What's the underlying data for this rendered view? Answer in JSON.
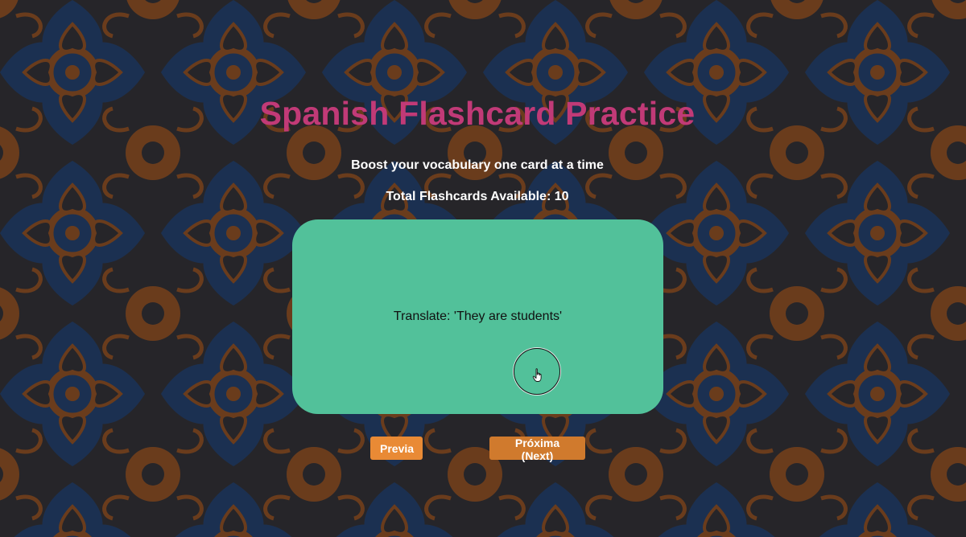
{
  "header": {
    "title": "Spanish Flashcard Practice",
    "subtitle": "Boost your vocabulary one card at a time",
    "total": "Total Flashcards Available: 10"
  },
  "card": {
    "prompt": "Translate: 'They are students'"
  },
  "controls": {
    "prev_label": "Previa",
    "next_label": "Próxima (Next)"
  },
  "colors": {
    "title": "#c13a77",
    "card": "#52c19a",
    "button_prev": "#e98a35",
    "button_next": "#d07a2d",
    "tile_blue": "#1c3a66",
    "tile_orange": "#8a4a1c"
  },
  "icons": {
    "cursor": "hand-pointer-icon"
  }
}
